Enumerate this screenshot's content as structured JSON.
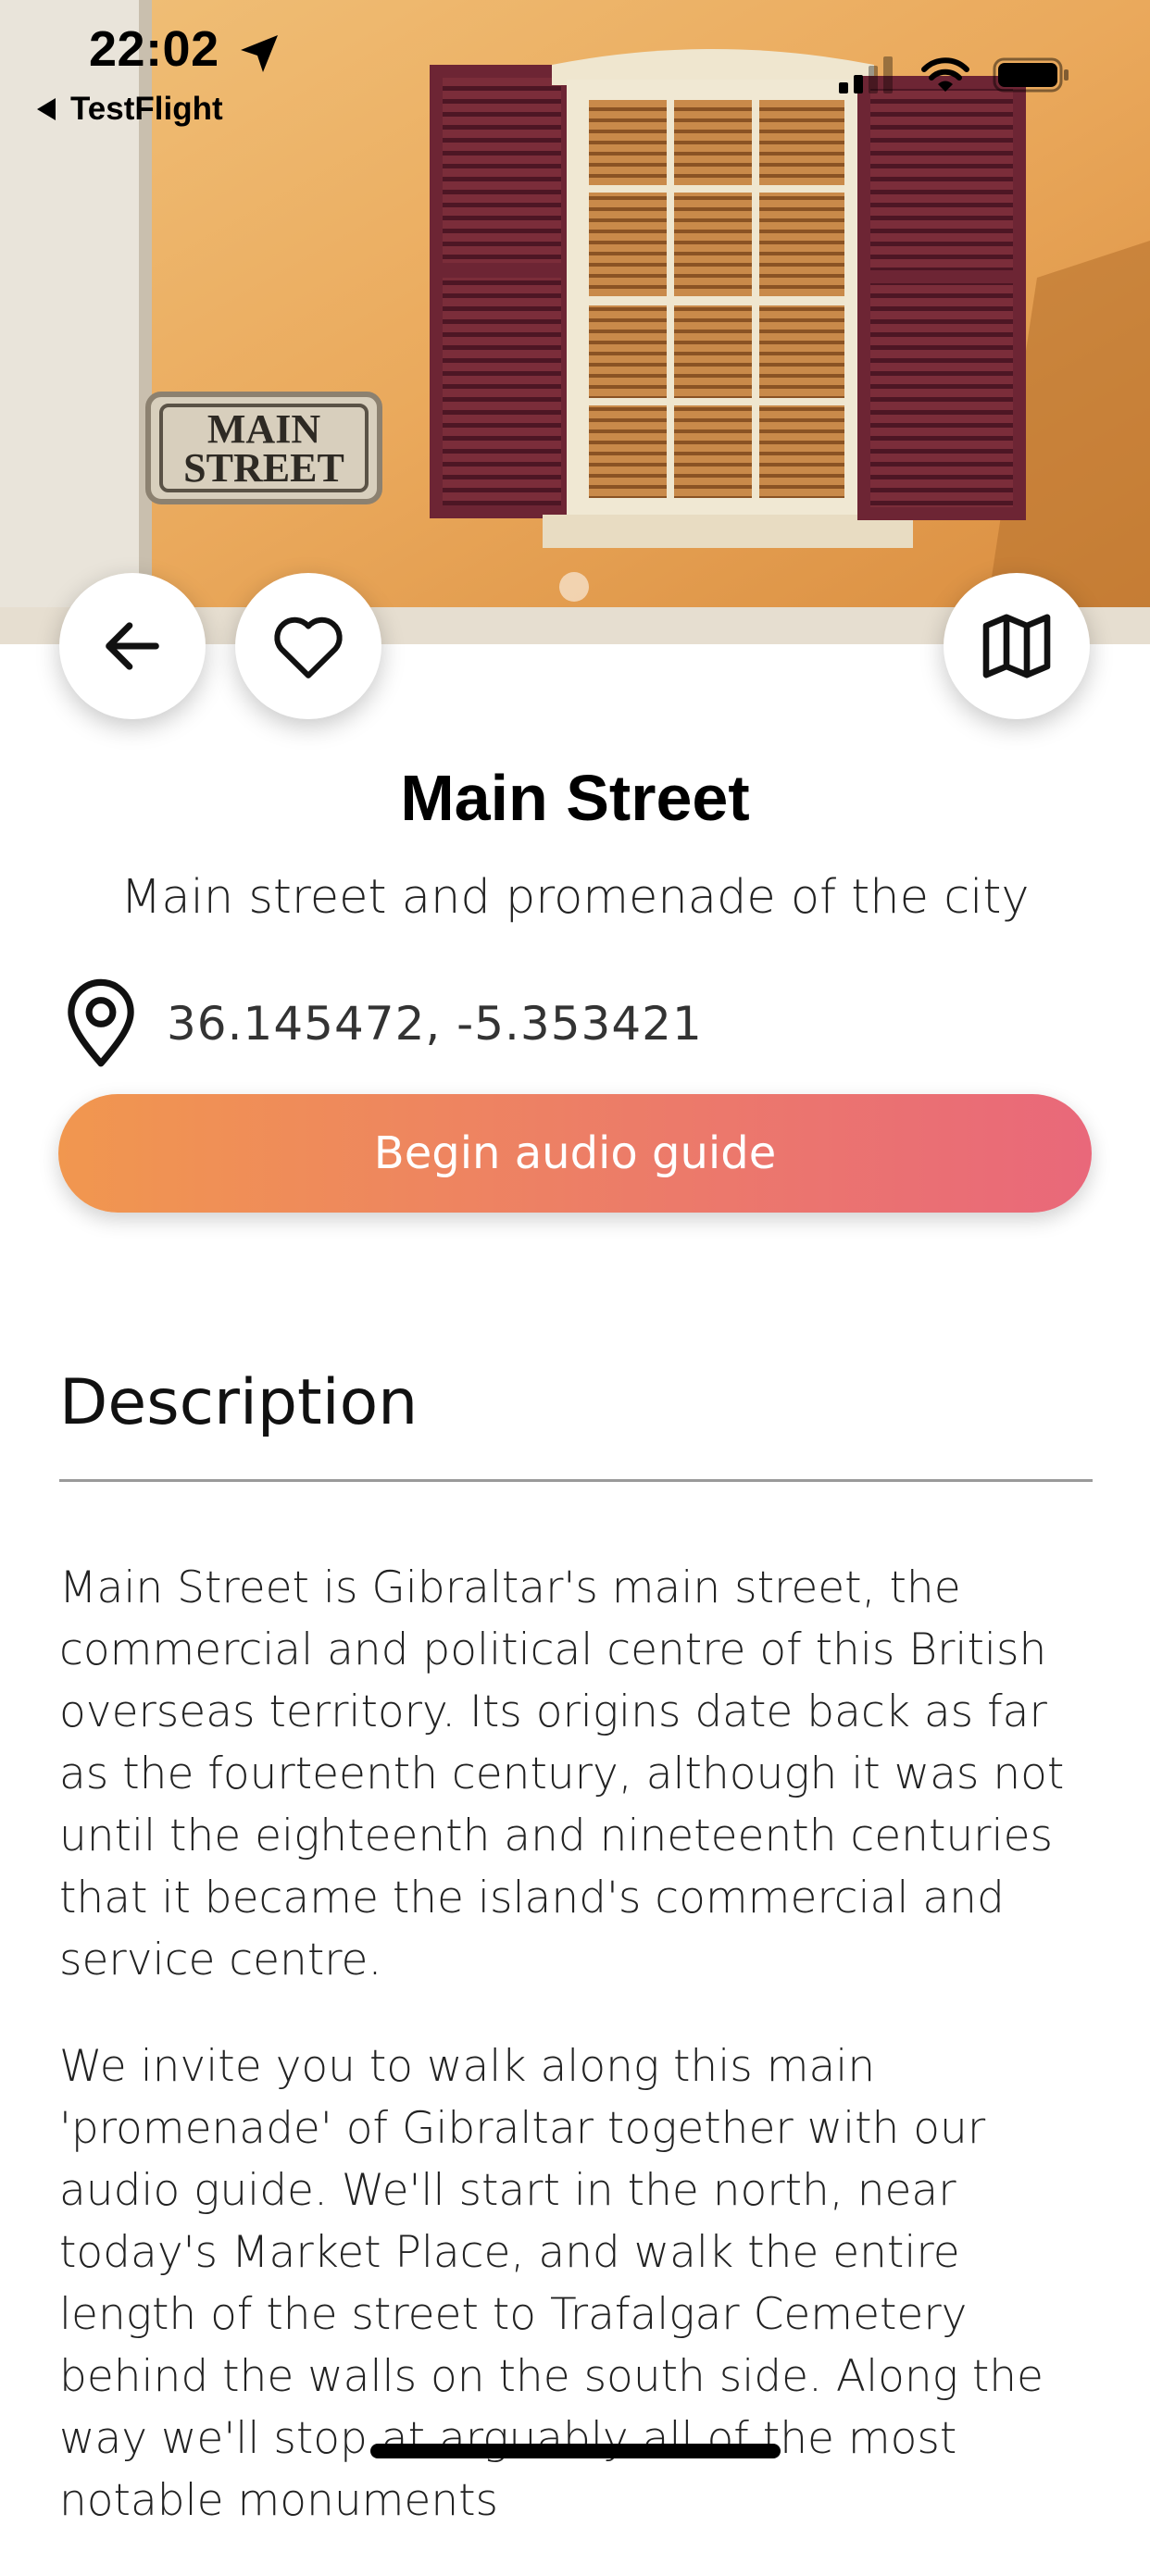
{
  "status_bar": {
    "time": "22:02",
    "back_app_label": "TestFlight"
  },
  "hero": {
    "sign_line1": "MAIN",
    "sign_line2": "STREET",
    "page_indicator": {
      "current": 1,
      "total": 1
    }
  },
  "actions": {
    "back_icon": "arrow-left-icon",
    "favorite_icon": "heart-icon",
    "map_icon": "map-icon"
  },
  "place": {
    "title": "Main Street",
    "subtitle": "Main street and promenade of the city",
    "coordinates": "36.145472, -5.353421",
    "location_icon": "location-pin-icon"
  },
  "cta": {
    "label": "Begin audio guide",
    "gradient_start": "#f1974f",
    "gradient_end": "#e9687a"
  },
  "description": {
    "heading": "Description",
    "paragraphs": [
      "Main Street is Gibraltar's main street, the commercial and political centre of this British overseas territory. Its origins date back as far as the fourteenth century, although it was not until the eighteenth and nineteenth centuries that it became the island's commercial and service centre.",
      "We invite you to walk along this main 'promenade' of Gibraltar together with our audio guide. We'll start in the north, near today's Market Place, and walk the entire length of the street to Trafalgar Cemetery behind the walls on the south side. Along the way we'll stop at arguably all of the most notable monuments"
    ]
  }
}
